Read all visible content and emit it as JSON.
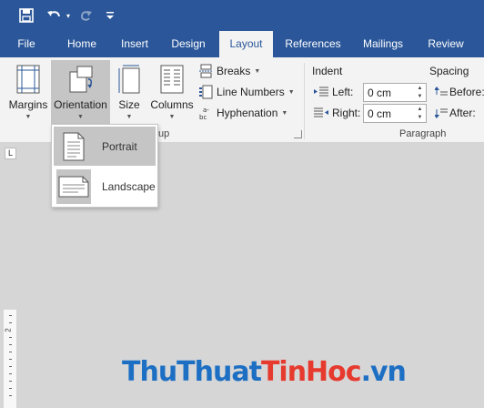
{
  "quick_access": {
    "save_icon": "save-icon",
    "undo_icon": "undo-icon",
    "redo_icon": "redo-icon",
    "customize_icon": "customize-qat-icon"
  },
  "tabs": [
    {
      "label": "File",
      "active": false
    },
    {
      "label": "Home",
      "active": false
    },
    {
      "label": "Insert",
      "active": false
    },
    {
      "label": "Design",
      "active": false
    },
    {
      "label": "Layout",
      "active": true
    },
    {
      "label": "References",
      "active": false
    },
    {
      "label": "Mailings",
      "active": false
    },
    {
      "label": "Review",
      "active": false
    }
  ],
  "ribbon": {
    "margins_label": "Margins",
    "orientation_label": "Orientation",
    "size_label": "Size",
    "columns_label": "Columns",
    "breaks_label": "Breaks",
    "line_numbers_label": "Line Numbers",
    "hyphenation_label": "Hyphenation",
    "page_setup_group_partial": "up",
    "indent_heading": "Indent",
    "indent_left_label": "Left:",
    "indent_left_value": "0 cm",
    "indent_right_label": "Right:",
    "indent_right_value": "0 cm",
    "spacing_heading": "Spacing",
    "spacing_before_label": "Before:",
    "spacing_after_label": "After:",
    "paragraph_group_label": "Paragraph"
  },
  "orientation_menu": {
    "items": [
      {
        "label": "Portrait",
        "icon": "portrait-page-icon",
        "highlighted": true
      },
      {
        "label": "Landscape",
        "icon": "landscape-page-icon",
        "highlighted": false
      }
    ]
  },
  "ruler": {
    "tab_selector": "L",
    "vertical_number": "2"
  },
  "watermark": {
    "part1": "ThuThuat",
    "part2": "TinHoc",
    "part3": ".vn"
  },
  "colors": {
    "ribbon_blue": "#2b579a",
    "ribbon_bg": "#f3f3f3",
    "document_bg": "#d6d6d6",
    "watermark_blue": "#1d6fc4",
    "watermark_red": "#e63a2e"
  }
}
